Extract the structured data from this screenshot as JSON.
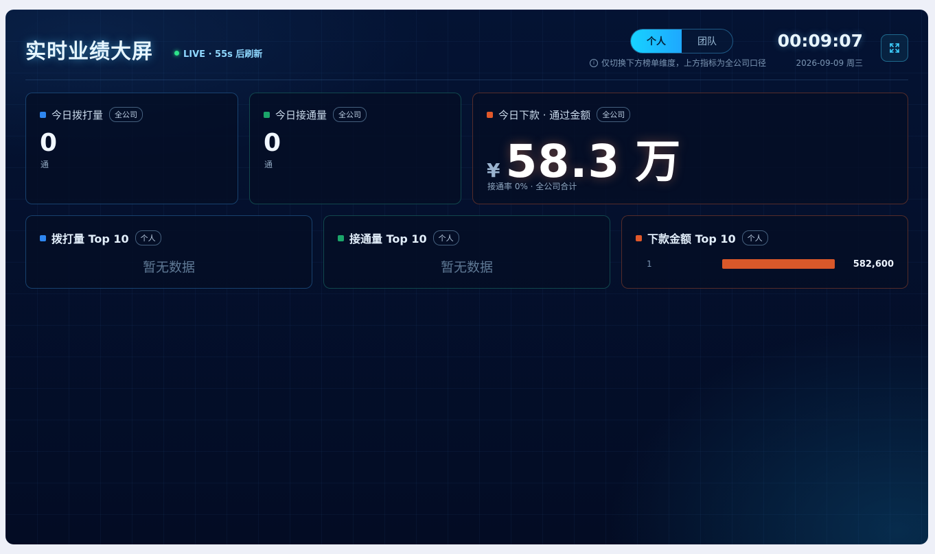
{
  "header": {
    "title": "实时业绩大屏",
    "live_text": "LIVE · 55s 后刷新",
    "scope_toggle": {
      "options": [
        "个人",
        "团队"
      ],
      "selected": "个人"
    },
    "toggle_note": "仅切换下方榜单维度，上方指标为全公司口径",
    "clock": "00:09:07",
    "date": "2026-09-09 周三"
  },
  "kpis": {
    "calls": {
      "label": "今日拨打量",
      "scope": "全公司",
      "value": "0",
      "unit": "通"
    },
    "connected": {
      "label": "今日接通量",
      "scope": "全公司",
      "value": "0",
      "unit": "通"
    },
    "amount": {
      "label": "今日下款 · 通过金额",
      "scope": "全公司",
      "currency": "¥",
      "value": "58.3",
      "unit": "万",
      "sub": "接通率 0% · 全公司合计"
    }
  },
  "rankings": {
    "calls_top": {
      "title": "拨打量 Top 10",
      "scope": "个人",
      "empty_text": "暂无数据"
    },
    "connected_top": {
      "title": "接通量 Top 10",
      "scope": "个人",
      "empty_text": "暂无数据"
    },
    "amount_top": {
      "title": "下款金额 Top 10",
      "scope": "个人",
      "rows": [
        {
          "rank": "1",
          "name": "",
          "value": "582,600",
          "fill_fraction": 1.0
        }
      ]
    }
  },
  "colors": {
    "accent_cyan": "#17d2ff",
    "calls_blue": "#2e86f0",
    "connected_green": "#1ba56a",
    "amount_orange": "#d9582a"
  }
}
